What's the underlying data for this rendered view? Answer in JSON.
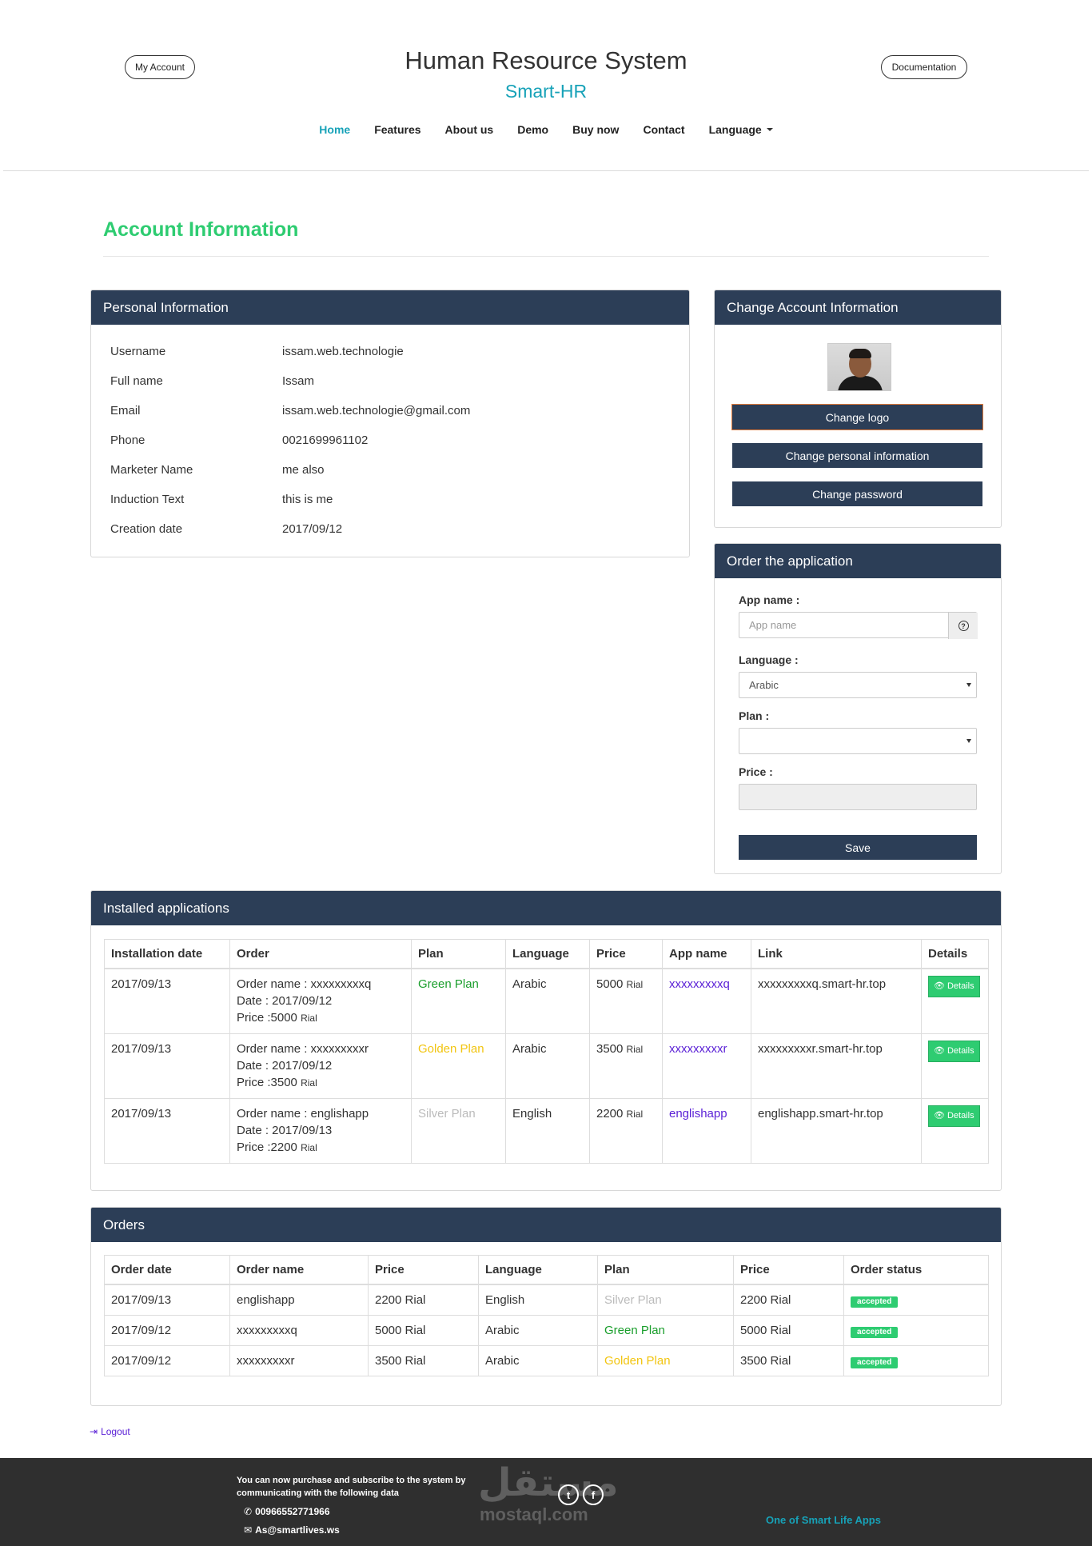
{
  "header": {
    "my_account": "My Account",
    "documentation": "Documentation",
    "title": "Human Resource System",
    "subtitle": "Smart-HR",
    "nav": [
      "Home",
      "Features",
      "About us",
      "Demo",
      "Buy now",
      "Contact",
      "Language"
    ]
  },
  "page_title": "Account Information",
  "personal": {
    "title": "Personal Information",
    "rows": [
      {
        "label": "Username",
        "value": "issam.web.technologie"
      },
      {
        "label": "Full name",
        "value": "Issam"
      },
      {
        "label": "Email",
        "value": "issam.web.technologie@gmail.com"
      },
      {
        "label": "Phone",
        "value": "0021699961102"
      },
      {
        "label": "Marketer Name",
        "value": "me also"
      },
      {
        "label": "Induction Text",
        "value": "this is me"
      },
      {
        "label": "Creation date",
        "value": "2017/09/12"
      }
    ]
  },
  "change_account": {
    "title": "Change Account Information",
    "change_logo": "Change logo",
    "change_personal": "Change personal information",
    "change_password": "Change password"
  },
  "order_app": {
    "title": "Order the application",
    "app_name_label": "App name :",
    "app_name_placeholder": "App name",
    "language_label": "Language :",
    "language_value": "Arabic",
    "plan_label": "Plan :",
    "plan_value": "",
    "price_label": "Price :",
    "save": "Save"
  },
  "installed": {
    "title": "Installed applications",
    "headers": [
      "Installation date",
      "Order",
      "Plan",
      "Language",
      "Price",
      "App name",
      "Link",
      "Details"
    ],
    "rows": [
      {
        "date": "2017/09/13",
        "order_name": "Order name : xxxxxxxxxq",
        "order_date": "Date : 2017/09/12",
        "order_price": "Price :5000",
        "order_unit": "Rial",
        "plan": "Green Plan",
        "language": "Arabic",
        "price": "5000",
        "unit": "Rial",
        "app": "xxxxxxxxxq",
        "link": "xxxxxxxxxq.smart-hr.top",
        "details": "Details"
      },
      {
        "date": "2017/09/13",
        "order_name": "Order name : xxxxxxxxxr",
        "order_date": "Date : 2017/09/12",
        "order_price": "Price :3500",
        "order_unit": "Rial",
        "plan": "Golden Plan",
        "language": "Arabic",
        "price": "3500",
        "unit": "Rial",
        "app": "xxxxxxxxxr",
        "link": "xxxxxxxxxr.smart-hr.top",
        "details": "Details"
      },
      {
        "date": "2017/09/13",
        "order_name": "Order name : englishapp",
        "order_date": "Date : 2017/09/13",
        "order_price": "Price :2200",
        "order_unit": "Rial",
        "plan": "Silver Plan",
        "language": "English",
        "price": "2200",
        "unit": "Rial",
        "app": "englishapp",
        "link": "englishapp.smart-hr.top",
        "details": "Details"
      }
    ]
  },
  "orders": {
    "title": "Orders",
    "headers": [
      "Order date",
      "Order name",
      "Price",
      "Language",
      "Plan",
      "Price",
      "Order status"
    ],
    "rows": [
      {
        "date": "2017/09/13",
        "name": "englishapp",
        "price": "2200 Rial",
        "language": "English",
        "plan": "Silver Plan",
        "price2": "2200 Rial",
        "status": "accepted"
      },
      {
        "date": "2017/09/12",
        "name": "xxxxxxxxxq",
        "price": "5000 Rial",
        "language": "Arabic",
        "plan": "Green Plan",
        "price2": "5000 Rial",
        "status": "accepted"
      },
      {
        "date": "2017/09/12",
        "name": "xxxxxxxxxr",
        "price": "3500 Rial",
        "language": "Arabic",
        "plan": "Golden Plan",
        "price2": "3500 Rial",
        "status": "accepted"
      }
    ]
  },
  "logout": "Logout",
  "footer": {
    "text": "You can now purchase and subscribe to the system by communicating with the following data",
    "phone": "00966552771966",
    "email": "As@smartlives.ws",
    "right": "One of Smart Life Apps",
    "watermark_ar": "مستقل",
    "watermark_en": "mostaql.com"
  },
  "colors": {
    "panel_header": "#2c3e57",
    "accent_green": "#2ecc71",
    "accent_teal": "#17a2b8",
    "link_purple": "#5b21d6"
  }
}
